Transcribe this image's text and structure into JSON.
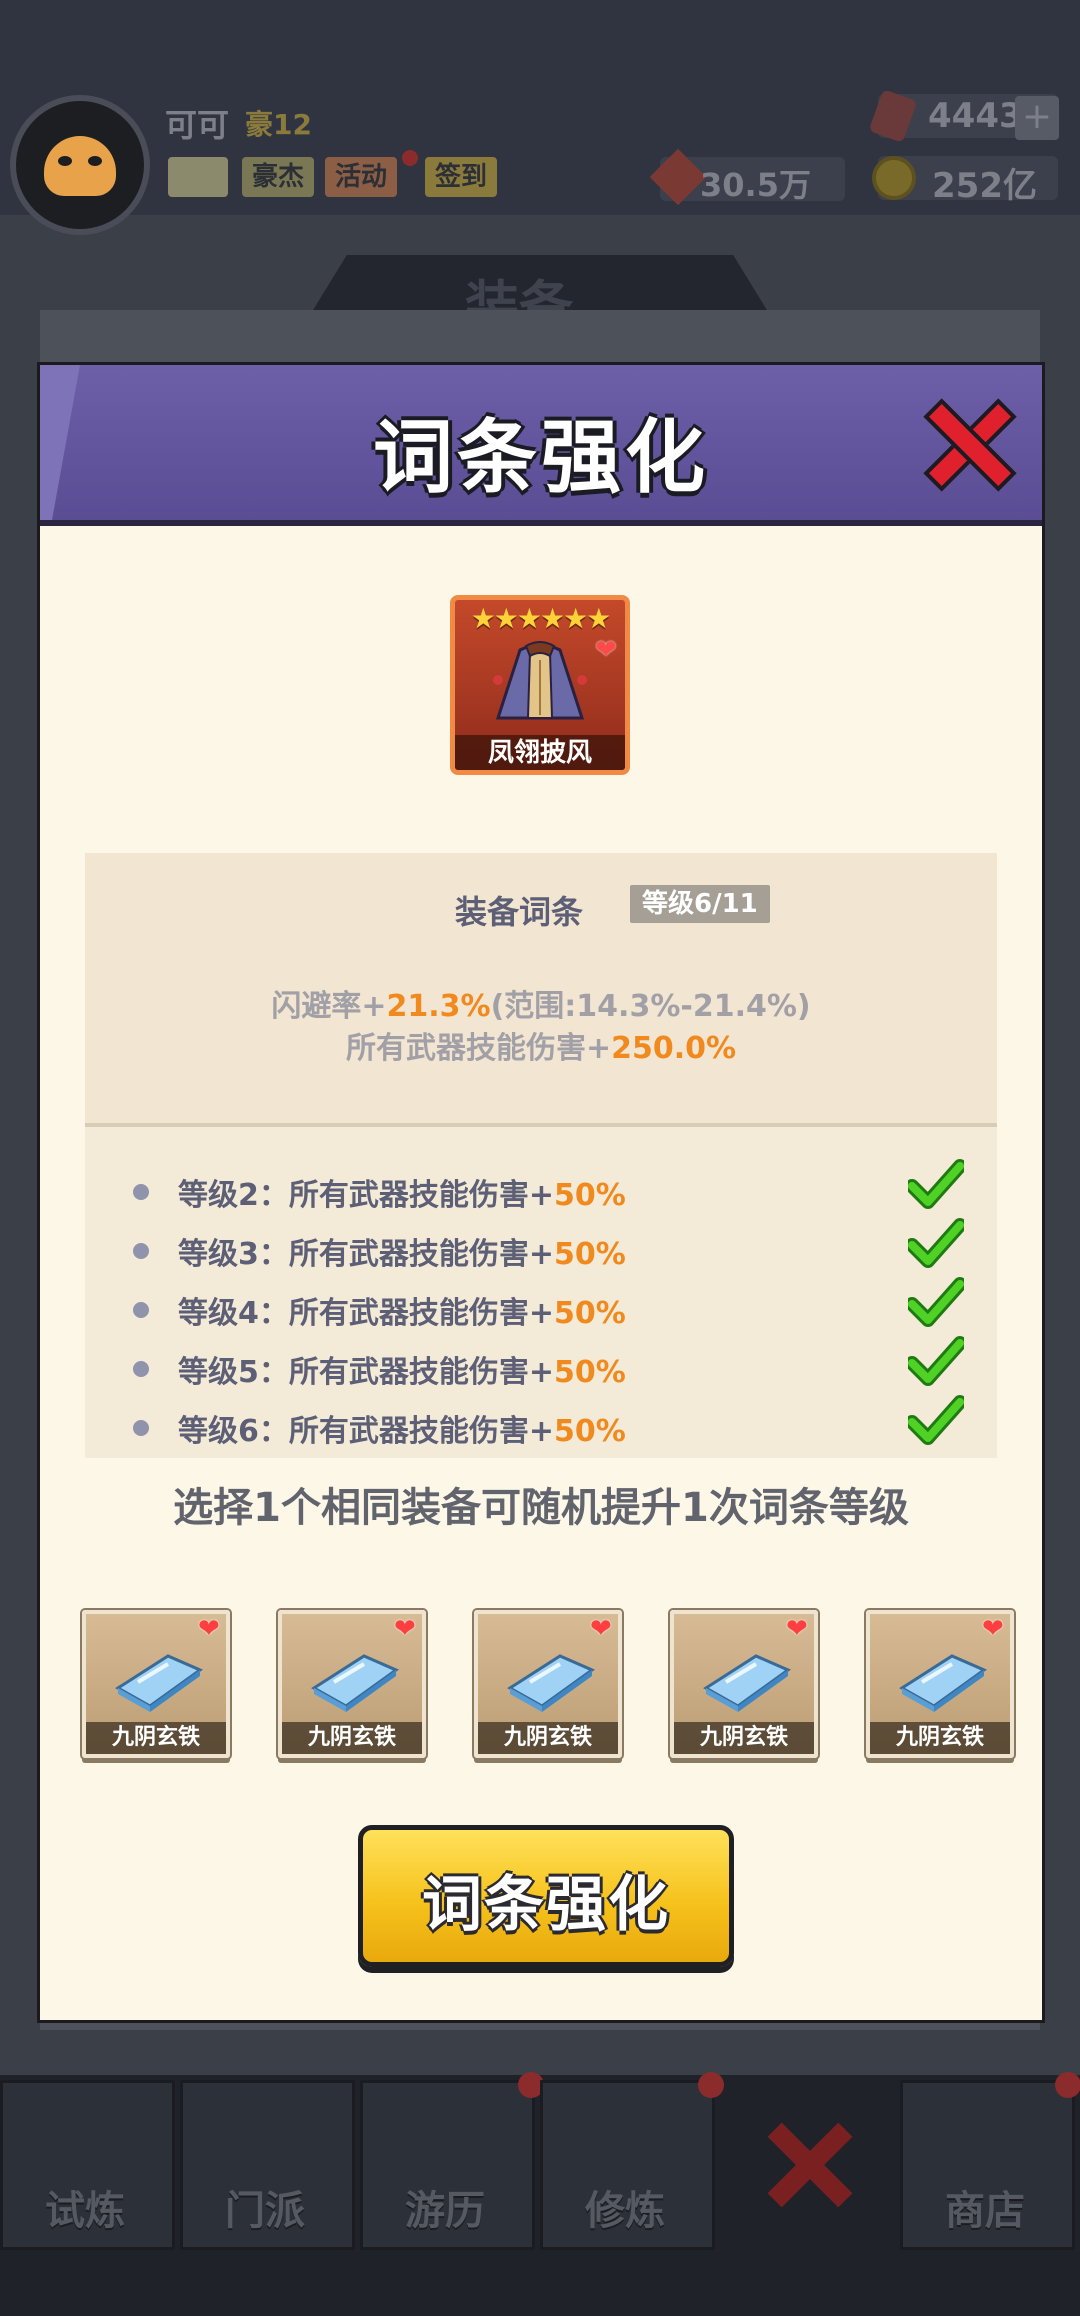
{
  "player": {
    "name": "可可",
    "vip": "豪12",
    "power": "30.5万",
    "gems": "4443",
    "coins": "252亿"
  },
  "top_buttons": {
    "hero": "豪杰",
    "event": "活动",
    "checkin": "签到"
  },
  "background": {
    "section_title": "装备"
  },
  "nav": {
    "items": [
      "试炼",
      "门派",
      "游历",
      "修炼",
      "商店"
    ]
  },
  "dialog": {
    "title": "词条强化",
    "item": {
      "name": "凤翎披风",
      "stars": "★★★★★★",
      "star_count": 6
    },
    "affix": {
      "title": "装备词条",
      "level": "等级6/11",
      "stat1_prefix": "闪避率+",
      "stat1_value": "21.3%",
      "stat1_suffix": "(范围:14.3%-21.4%)",
      "stat2_prefix": "所有武器技能伤害+",
      "stat2_value": "250.0%"
    },
    "levels": [
      {
        "label": "等级2：所有武器技能伤害+",
        "value": "50%",
        "unlocked": true
      },
      {
        "label": "等级3：所有武器技能伤害+",
        "value": "50%",
        "unlocked": true
      },
      {
        "label": "等级4：所有武器技能伤害+",
        "value": "50%",
        "unlocked": true
      },
      {
        "label": "等级5：所有武器技能伤害+",
        "value": "50%",
        "unlocked": true
      },
      {
        "label": "等级6：所有武器技能伤害+",
        "value": "50%",
        "unlocked": true
      }
    ],
    "hint": "选择1个相同装备可随机提升1次词条等级",
    "materials": [
      "九阴玄铁",
      "九阴玄铁",
      "九阴玄铁",
      "九阴玄铁",
      "九阴玄铁"
    ],
    "button_label": "词条强化"
  },
  "colors": {
    "header": "#5f52a0",
    "highlight": "#f08a1e",
    "button": "#f6c21c",
    "close": "#e0202c"
  }
}
